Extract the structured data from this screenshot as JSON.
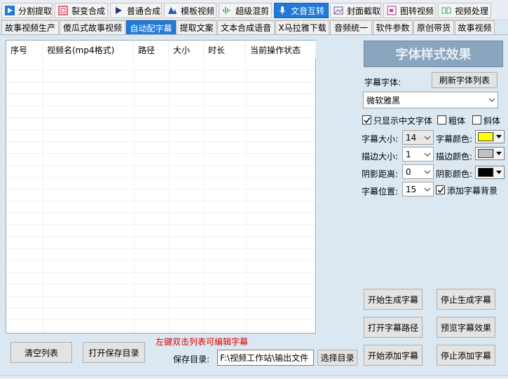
{
  "top_tabs": [
    {
      "label": "分割提取",
      "icon": "split-icon",
      "color": "#1f7ad8"
    },
    {
      "label": "裂变合成",
      "icon": "fission-icon",
      "color": "#d93b57"
    },
    {
      "label": "普通合成",
      "icon": "play-icon",
      "color": "#1a3a7a"
    },
    {
      "label": "模板视频",
      "icon": "template-icon",
      "color": "#1f5fa8"
    },
    {
      "label": "超级混剪",
      "icon": "waveform-icon",
      "color": "#39a84a"
    },
    {
      "label": "文音互转",
      "icon": "microphone-icon",
      "color": "#ffffff",
      "active": true
    },
    {
      "label": "封面截取",
      "icon": "image-icon",
      "color": "#6a4fa8"
    },
    {
      "label": "图转视频",
      "icon": "photo-video-icon",
      "color": "#c0399a"
    },
    {
      "label": "视频处理",
      "icon": "video-process-icon",
      "color": "#3aa86a"
    }
  ],
  "sub_tabs": [
    {
      "label": "故事视频生产"
    },
    {
      "label": "傻瓜式故事视频"
    },
    {
      "label": "自动配字幕",
      "active": true
    },
    {
      "label": "提取文案"
    },
    {
      "label": "文本合成语音"
    },
    {
      "label": "X马拉雅下载"
    },
    {
      "label": "音频统一"
    },
    {
      "label": "软件参数"
    },
    {
      "label": "原创带货"
    },
    {
      "label": "故事视频"
    }
  ],
  "list": {
    "columns": [
      "序号",
      "视频名(mp4格式)",
      "路径",
      "大小",
      "时长",
      "当前操作状态"
    ]
  },
  "bottom": {
    "clear_list": "清空列表",
    "open_save_dir": "打开保存目录",
    "hint": "左键双击列表可编辑字幕",
    "save_dir_label": "保存目录:",
    "save_dir_value": "F:\\视频工作站\\输出文件",
    "choose_dir": "选择目录"
  },
  "style": {
    "preview_text": "字体样式效果",
    "font_label": "字幕字体:",
    "refresh_fonts": "刷新字体列表",
    "font_value": "微软雅黑",
    "only_chinese": "只显示中文字体",
    "bold": "粗体",
    "italic": "斜体",
    "size_label": "字幕大小:",
    "size_value": "14",
    "color_label": "字幕颜色:",
    "color_value": "#ffff00",
    "stroke_size_label": "描边大小:",
    "stroke_size_value": "1",
    "stroke_color_label": "描边颜色:",
    "stroke_color_value": "#c0c0c0",
    "shadow_dist_label": "阴影距离:",
    "shadow_dist_value": "0",
    "shadow_color_label": "阴影颜色:",
    "shadow_color_value": "#000000",
    "position_label": "字幕位置:",
    "position_value": "15",
    "add_bg": "添加字幕背景"
  },
  "actions": {
    "start_gen": "开始生成字幕",
    "stop_gen": "停止生成字幕",
    "open_sub_path": "打开字幕路径",
    "preview_effect": "预览字幕效果",
    "start_add": "开始添加字幕",
    "stop_add": "停止添加字幕"
  }
}
